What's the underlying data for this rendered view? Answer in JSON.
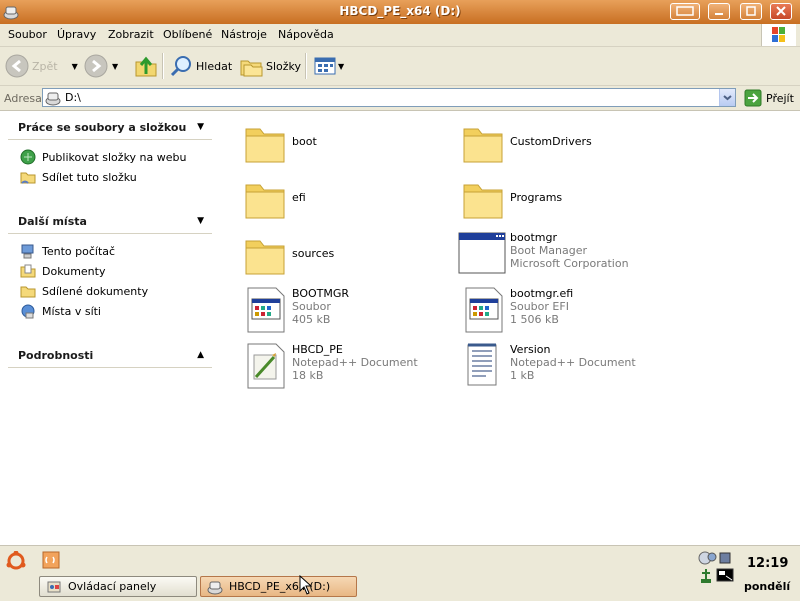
{
  "window": {
    "title": "HBCD_PE_x64 (D:)",
    "accent_color": "#d47a2c"
  },
  "menu": {
    "items": [
      "Soubor",
      "Úpravy",
      "Zobrazit",
      "Oblíbené",
      "Nástroje",
      "Nápověda"
    ]
  },
  "toolbar": {
    "back_label": "Zpět",
    "search_label": "Hledat",
    "folders_label": "Složky"
  },
  "address": {
    "label": "Adresa",
    "value": "D:\\",
    "go_label": "Přejít"
  },
  "left_panel": {
    "file_tasks": {
      "title": "Práce se soubory a složkou",
      "items": [
        "Publikovat složky na webu",
        "Sdílet tuto složku"
      ]
    },
    "other_places": {
      "title": "Další místa",
      "items": [
        "Tento počítač",
        "Dokumenty",
        "Sdílené dokumenty",
        "Místa v síti"
      ]
    },
    "details": {
      "title": "Podrobnosti"
    }
  },
  "files": [
    {
      "name": "boot",
      "type": "folder-icon"
    },
    {
      "name": "CustomDrivers",
      "type": "folder-icon"
    },
    {
      "name": "efi",
      "type": "folder-icon"
    },
    {
      "name": "Programs",
      "type": "folder-icon"
    },
    {
      "name": "sources",
      "type": "folder-icon"
    },
    {
      "name": "bootmgr",
      "line2": "Boot Manager",
      "line3": "Microsoft Corporation",
      "type": "application-icon"
    },
    {
      "name": "BOOTMGR",
      "line2": "Soubor",
      "line3": "405 kB",
      "type": "system-file-icon"
    },
    {
      "name": "bootmgr.efi",
      "line2": "Soubor EFI",
      "line3": "1 506 kB",
      "type": "system-file-icon"
    },
    {
      "name": "HBCD_PE",
      "line2": "Notepad++ Document",
      "line3": "18 kB",
      "type": "notepad-document-icon"
    },
    {
      "name": "Version",
      "line2": "Notepad++ Document",
      "line3": "1 kB",
      "type": "text-document-icon"
    }
  ],
  "taskbar": {
    "tasks": [
      {
        "label": "Ovládací panely"
      },
      {
        "label": "HBCD_PE_x64 (D:)"
      }
    ],
    "clock": "12:19",
    "day": "pondělí"
  }
}
